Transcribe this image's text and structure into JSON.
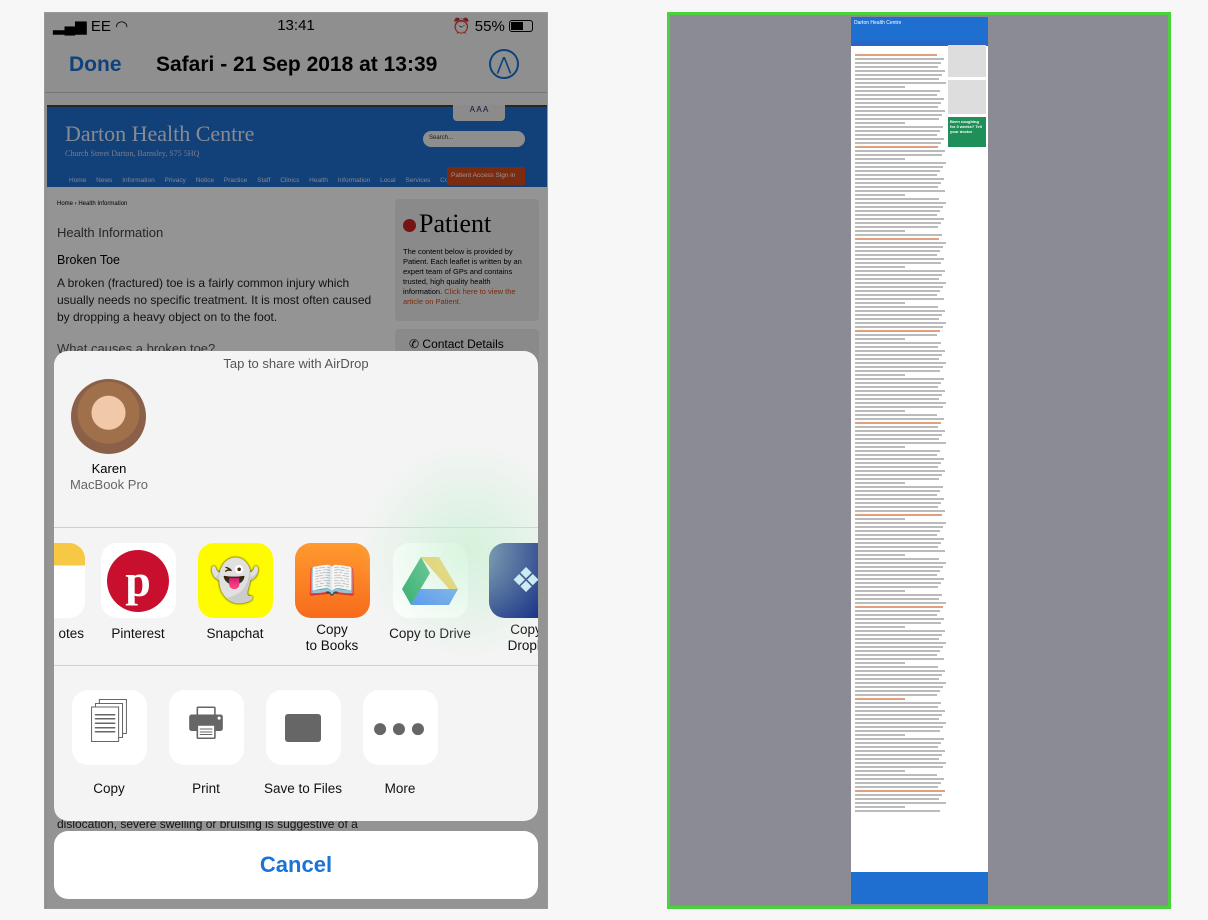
{
  "status": {
    "carrier": "EE",
    "time": "13:41",
    "battery": "55%"
  },
  "nav": {
    "done": "Done",
    "title": "Safari - 21 Sep 2018 at 13:39"
  },
  "web": {
    "title": "Darton Health Centre",
    "subtitle": "Church Street Darton, Barnsley, S75 5HQ",
    "aaa": "A A A",
    "search_placeholder": "Search...",
    "menu": "Home News Information Privacy Notice Practice Staff Clinics Health Information Local Services Contact",
    "patient_access": "Patient Access  Sign in",
    "breadcrumb": "Home › Health Information",
    "heading": "Health Information",
    "article_title": "Broken Toe",
    "intro": "A broken (fractured) toe is a fairly common injury which usually needs no specific treatment. It is most often caused by dropping a heavy object on to the foot.",
    "section": "What causes a broken toe?",
    "patient_logo": "Patient",
    "patient_text": "The content below is provided by Patient. Each leaflet is written by an expert team of GPs and contains trusted, high quality health information.",
    "patient_link": "Click here to view the article on Patient.",
    "contact": "Contact Details",
    "footer_text": "dislocation, severe swelling or bruising is suggestive of a"
  },
  "share": {
    "airdrop_hint": "Tap to share with AirDrop",
    "person_name": "Karen",
    "person_device": "MacBook Pro",
    "apps": [
      {
        "label": "otes",
        "icon": "notes-icon"
      },
      {
        "label": "Pinterest",
        "icon": "pinterest-icon"
      },
      {
        "label": "Snapchat",
        "icon": "snapchat-icon"
      },
      {
        "label": "Copy\nto Books",
        "icon": "books-icon"
      },
      {
        "label": "Copy to Drive",
        "icon": "google-drive-icon"
      },
      {
        "label": "Copy\nDropb",
        "icon": "dropbox-icon"
      }
    ],
    "actions": [
      {
        "label": "Copy",
        "icon": "copy-icon"
      },
      {
        "label": "Print",
        "icon": "print-icon"
      },
      {
        "label": "Save to Files",
        "icon": "folder-icon"
      },
      {
        "label": "More",
        "icon": "more-icon"
      }
    ],
    "cancel": "Cancel"
  },
  "thumbnail": {
    "title": "Darton Health Centre",
    "ad": "Been coughing for 3 weeks? Tell your doctor"
  },
  "colors": {
    "accent": "#1a73d6",
    "site_blue": "#1f6fd1",
    "selection": "#4cd13e"
  }
}
